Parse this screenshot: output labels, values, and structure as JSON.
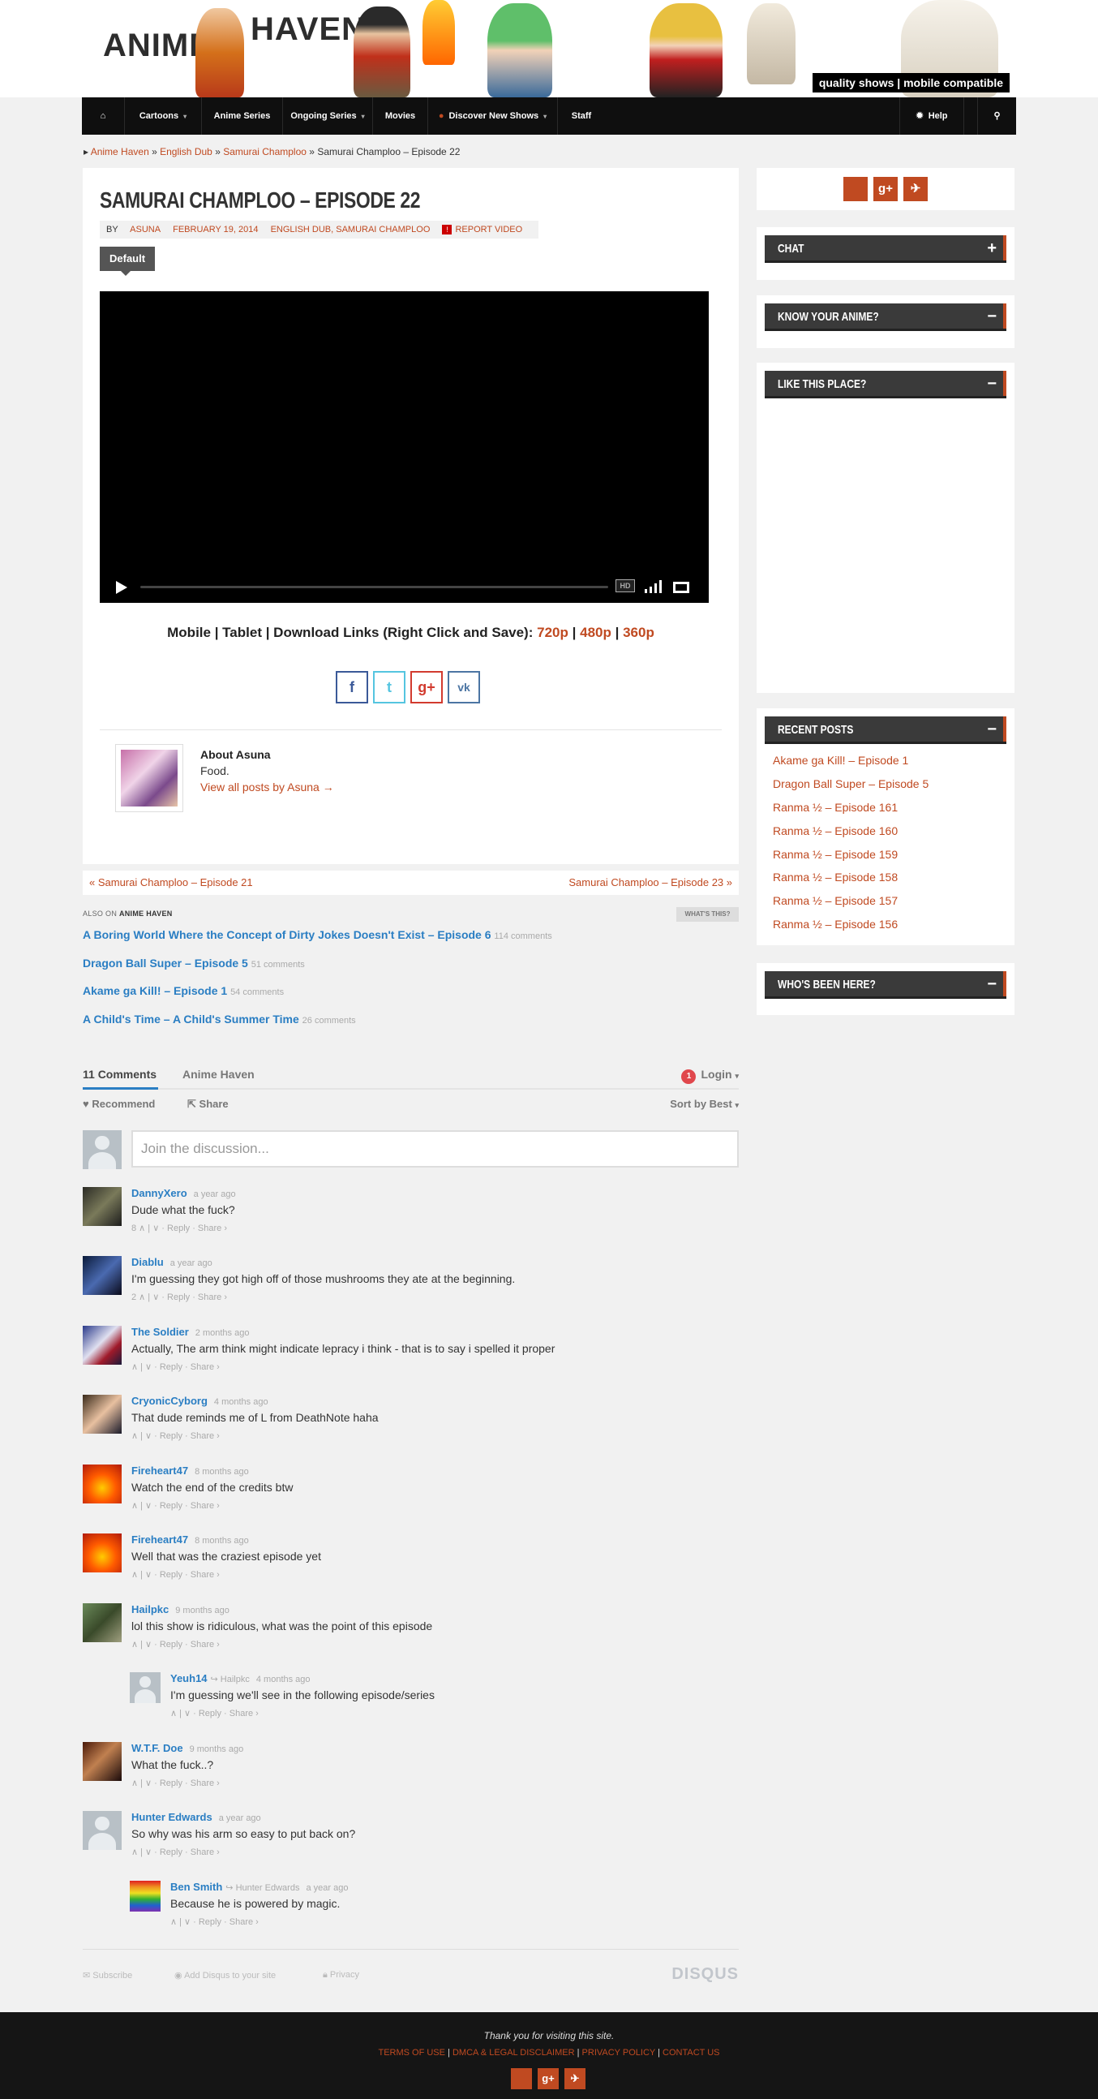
{
  "site": {
    "logo_word1": "ANIME",
    "logo_word2": "HAVEN",
    "tagline": "quality shows | mobile compatible"
  },
  "nav": {
    "home_icon": "home-icon",
    "items": [
      "Cartoons",
      "Anime Series",
      "Ongoing Series",
      "Movies",
      "Discover New Shows",
      "Staff"
    ],
    "help": "Help",
    "search_icon": "search-icon"
  },
  "breadcrumb": {
    "items": [
      "Anime Haven",
      "English Dub",
      "Samurai Champloo",
      "Samurai Champloo – Episode 22"
    ],
    "sep": "»"
  },
  "post": {
    "title": "SAMURAI CHAMPLOO – EPISODE 22",
    "by": "BY",
    "author": "ASUNA",
    "date": "FEBRUARY 19, 2014",
    "categories": "ENGLISH DUB, SAMURAI CHAMPLOO",
    "report": "REPORT VIDEO",
    "tab": "Default",
    "player": {
      "hd": "HD"
    },
    "links_prefix": "Mobile | Tablet | Download Links (Right Click and Save):",
    "link_720": "720p",
    "link_480": "480p",
    "link_360": "360p",
    "link_sep": "|",
    "share": {
      "facebook": "f",
      "twitter": "t",
      "gplus": "g+",
      "vk": "vk"
    },
    "about_title": "About Asuna",
    "about_text": "Food.",
    "about_link": "View all posts by Asuna →"
  },
  "prevnext": {
    "prev": "« Samurai Champloo – Episode 21",
    "next": "Samurai Champloo – Episode 23 »"
  },
  "also_on": {
    "prefix": "ALSO ON",
    "site": "ANIME HAVEN",
    "whats_this": "WHAT'S THIS?",
    "items": [
      {
        "title": "A Boring World Where the Concept of Dirty Jokes Doesn't Exist – Episode 6",
        "count": "114 comments"
      },
      {
        "title": "Dragon Ball Super – Episode 5",
        "count": "51 comments"
      },
      {
        "title": "Akame ga Kill! – Episode 1",
        "count": "54 comments"
      },
      {
        "title": "A Child's Time – A Child's Summer Time",
        "count": "26 comments"
      }
    ]
  },
  "disqus": {
    "tab_comments": "11 Comments",
    "tab_site": "Anime Haven",
    "login_badge": "1",
    "login": "Login",
    "recommend": "Recommend",
    "share": "Share",
    "sort": "Sort by Best",
    "placeholder": "Join the discussion...",
    "comments": [
      {
        "name": "DannyXero",
        "time": "a year ago",
        "text": "Dude what the fuck?",
        "footer": "8 ∧ | ∨ · Reply · Share ›"
      },
      {
        "name": "Diablu",
        "time": "a year ago",
        "text": "I'm guessing they got high off of those mushrooms they ate at the beginning.",
        "footer": "2 ∧ | ∨ · Reply · Share ›"
      },
      {
        "name": "The Soldier",
        "time": "2 months ago",
        "text": "Actually, The arm think might indicate lepracy i think - that is to say i spelled it proper",
        "footer": "∧ | ∨ · Reply · Share ›"
      },
      {
        "name": "CryonicCyborg",
        "time": "4 months ago",
        "text": "That dude reminds me of L from DeathNote haha",
        "footer": "∧ | ∨ · Reply · Share ›"
      },
      {
        "name": "Fireheart47",
        "time": "8 months ago",
        "text": "Watch the end of the credits btw",
        "footer": "∧ | ∨ · Reply · Share ›"
      },
      {
        "name": "Fireheart47",
        "time": "8 months ago",
        "text": "Well that was the craziest episode yet",
        "footer": "∧ | ∨ · Reply · Share ›"
      },
      {
        "name": "Hailpkc",
        "time": "9 months ago",
        "text": "lol this show is ridiculous, what was the point of this episode",
        "footer": "∧ | ∨ · Reply · Share ›"
      },
      {
        "name": "Yeuh14",
        "reply_to": "↪ Hailpkc",
        "time": "4 months ago",
        "text": "I'm guessing we'll see in the following episode/series",
        "footer": "∧ | ∨ · Reply · Share ›"
      },
      {
        "name": "W.T.F. Doe",
        "time": "9 months ago",
        "text": "What the fuck..?",
        "footer": "∧ | ∨ · Reply · Share ›"
      },
      {
        "name": "Hunter Edwards",
        "time": "a year ago",
        "text": "So why was his arm so easy to put back on?",
        "footer": "∧ | ∨ · Reply · Share ›"
      },
      {
        "name": "Ben Smith",
        "reply_to": "↪ Hunter Edwards",
        "time": "a year ago",
        "text": "Because he is powered by magic.",
        "footer": "∧ | ∨ · Reply · Share ›"
      }
    ],
    "footer_subscribe": "Subscribe",
    "footer_add": "Add Disqus to your site",
    "footer_privacy": "Privacy",
    "logo": "DISQUS"
  },
  "sidebar": {
    "chat": "CHAT",
    "know": "KNOW YOUR ANIME?",
    "like": "LIKE THIS PLACE?",
    "recent": "RECENT POSTS",
    "recent_posts": [
      "Akame ga Kill! – Episode 1",
      "Dragon Ball Super – Episode 5",
      "Ranma ½ – Episode 161",
      "Ranma ½ – Episode 160",
      "Ranma ½ – Episode 159",
      "Ranma ½ – Episode 158",
      "Ranma ½ – Episode 157",
      "Ranma ½ – Episode 156"
    ],
    "who": "WHO'S BEEN HERE?"
  },
  "footer": {
    "thanks": "Thank you for visiting this site.",
    "terms": "TERMS OF USE",
    "dmca": "DMCA & LEGAL DISCLAIMER",
    "privacy": "PRIVACY POLICY",
    "contact": "CONTACT US",
    "sep": "|"
  },
  "colors": {
    "accent": "#c04a21",
    "nav_bg": "#0f0f0f",
    "link_blue": "#2a7ec3",
    "widget_head": "#3a3a3a"
  }
}
